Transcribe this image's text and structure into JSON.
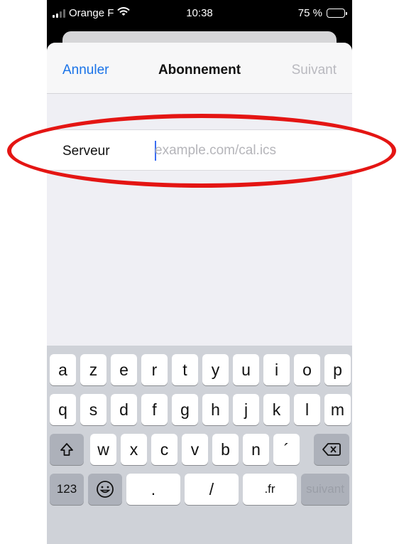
{
  "status": {
    "carrier": "Orange F",
    "time": "10:38",
    "battery": "75 %",
    "battery_level": 0.75
  },
  "navbar": {
    "cancel": "Annuler",
    "title": "Abonnement",
    "next": "Suivant"
  },
  "form": {
    "server_label": "Serveur",
    "server_placeholder": "example.com/cal.ics"
  },
  "keyboard": {
    "row1": [
      "a",
      "z",
      "e",
      "r",
      "t",
      "y",
      "u",
      "i",
      "o",
      "p"
    ],
    "row2": [
      "q",
      "s",
      "d",
      "f",
      "g",
      "h",
      "j",
      "k",
      "l",
      "m"
    ],
    "row3": [
      "w",
      "x",
      "c",
      "v",
      "b",
      "n",
      "´"
    ],
    "numbers": "123",
    "dot": ".",
    "slash": "/",
    "domain": ".fr",
    "send": "suivant"
  },
  "annotation": {
    "color": "#e41513"
  }
}
